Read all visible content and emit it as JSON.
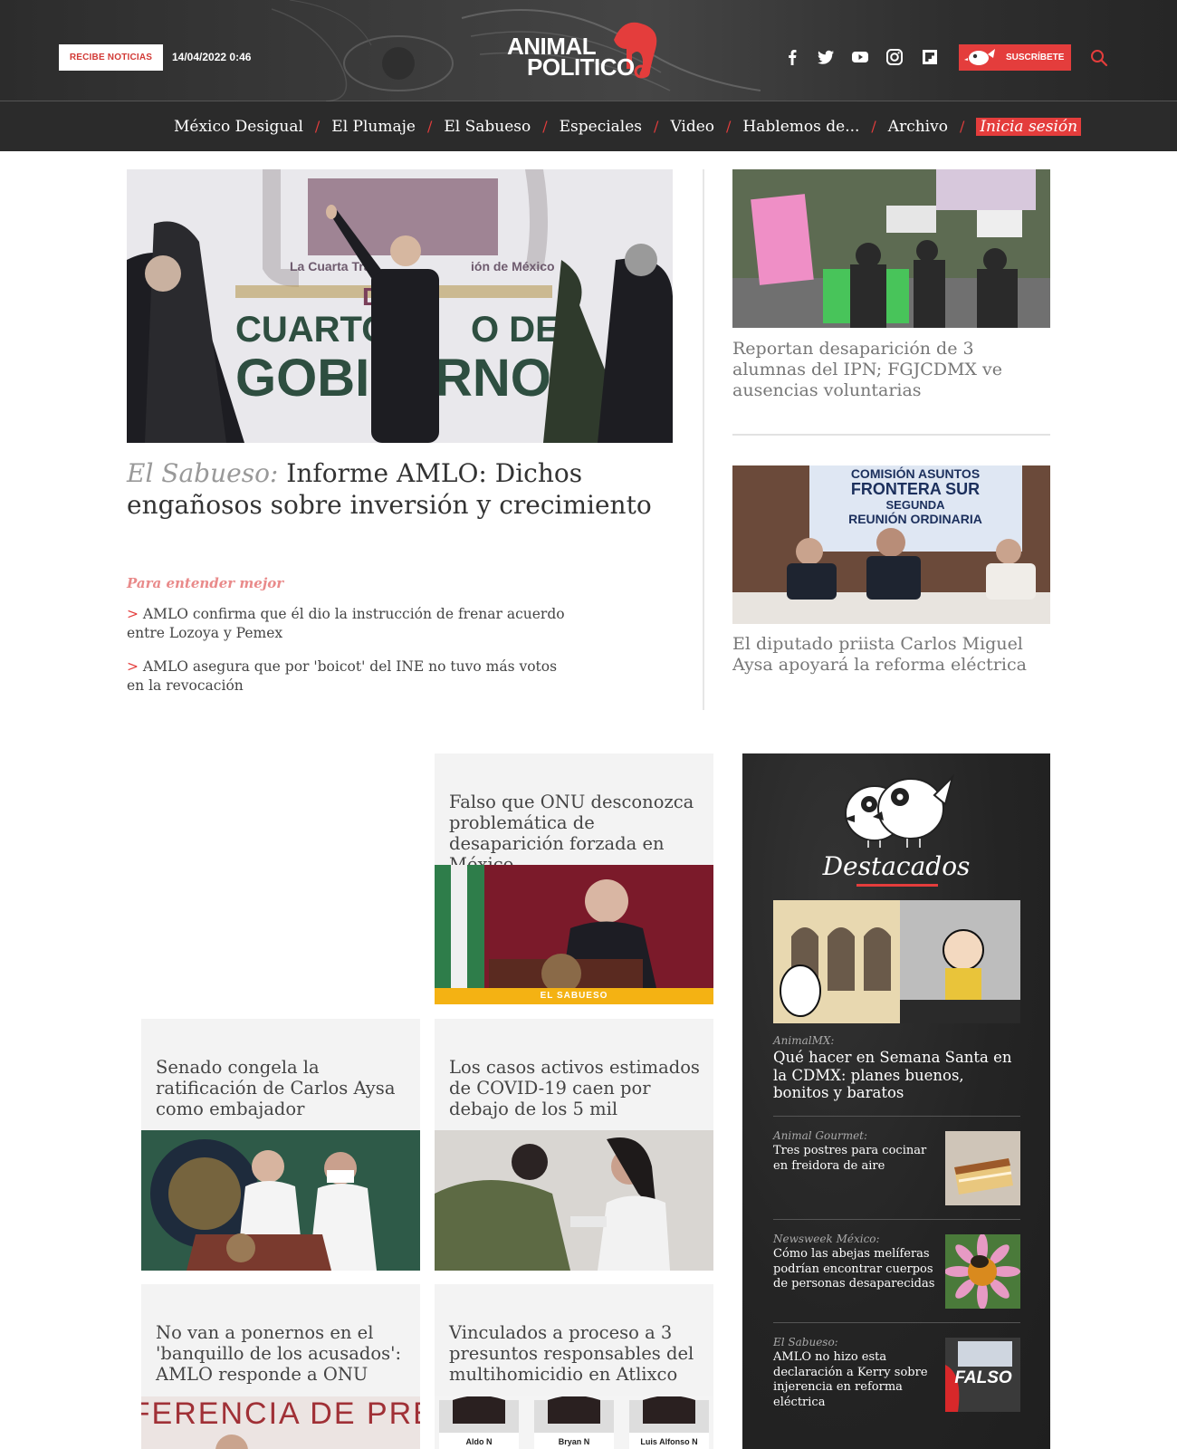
{
  "header": {
    "news_button": "RECIBE NOTICIAS",
    "datetime": "14/04/2022 0:46",
    "logo_line1": "ANIMAL",
    "logo_line2": "POLITICO",
    "social_icons": [
      "facebook-icon",
      "twitter-icon",
      "youtube-icon",
      "instagram-icon",
      "flipboard-icon"
    ],
    "subscribe_label": "SUSCRÍBETE",
    "brand_color": "#e43d3c"
  },
  "nav": {
    "items": [
      "México Desigual",
      "El Plumaje",
      "El Sabueso",
      "Especiales",
      "Video",
      "Hablemos de...",
      "Archivo"
    ],
    "separator": "/",
    "login": "Inicia sesión"
  },
  "hero": {
    "kicker": "El Sabueso:",
    "title": " Informe AMLO: Dichos engañosos sobre inversión y crecimiento",
    "image_text_1": "La Cuarta Tra",
    "image_text_2": "ión de México",
    "image_text_3": "D",
    "image_text_4": "CUARTO",
    "image_text_5": "O DE",
    "image_text_6": "GOBI",
    "image_text_7": "RNO",
    "understand_label": "Para entender mejor",
    "related": [
      {
        "marker": ">",
        "text": " AMLO confirma que él dio la instrucción de frenar acuerdo entre Lozoya y Pemex"
      },
      {
        "marker": ">",
        "text": " AMLO asegura que por 'boicot' del INE no tuvo más votos en la revocación"
      }
    ]
  },
  "side": [
    {
      "title": "Reportan desaparición de 3 alumnas del IPN; FGJCDMX ve ausencias voluntarias"
    },
    {
      "title": "El diputado priista Carlos Miguel Aysa apoyará la reforma eléctrica",
      "banner_1": "COMISIÓN ASUNTOS",
      "banner_2": "FRONTERA SUR",
      "banner_3": "SEGUNDA",
      "banner_4": "REUNIÓN ORDINARIA"
    }
  ],
  "cards": [
    {
      "title": "Falso que ONU desconozca problemática de desaparición forzada en México",
      "tag": "EL SABUESO"
    },
    {
      "title": "Senado congela la ratificación de Carlos Aysa como embajador"
    },
    {
      "title": "Los casos activos estimados de COVID-19 caen por debajo de los 5 mil"
    },
    {
      "title": "No van a ponernos en el 'banquillo de los acusados': AMLO responde a ONU",
      "image_text": "CONFERENCIA DE PRENSA"
    },
    {
      "title": "Vinculados a proceso a 3 presuntos responsables del multihomicidio en Atlixco",
      "names": [
        "Aldo N",
        "Bryan N",
        "Luis Alfonso N"
      ]
    }
  ],
  "destacados": {
    "title": "Destacados",
    "main": {
      "kicker": "AnimalMX:",
      "title": "Qué hacer en Semana Santa en la CDMX: planes buenos, bonitos y baratos"
    },
    "rows": [
      {
        "kicker": "Animal Gourmet:",
        "title": "Tres postres para cocinar en freidora de aire"
      },
      {
        "kicker": "Newsweek México:",
        "title": "Cómo las abejas melíferas podrían encontrar cuerpos de personas desaparecidas"
      },
      {
        "kicker": "El Sabueso:",
        "title": "AMLO no hizo esta declaración a Kerry sobre injerencia en reforma eléctrica",
        "image_label": "FALSO"
      }
    ]
  }
}
